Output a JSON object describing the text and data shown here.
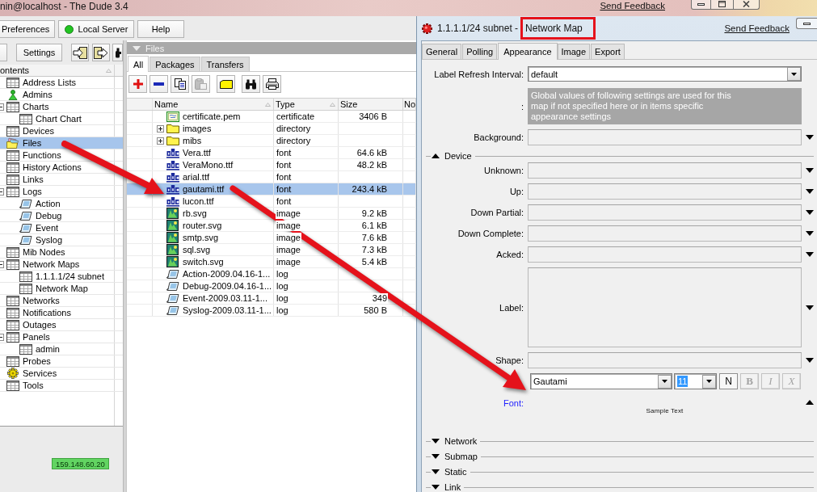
{
  "main_window": {
    "title": "nin@localhost - The Dude 3.4",
    "feedback_link": "Send Feedback",
    "preferences_button": "Preferences",
    "server_button": {
      "label": "Local Server",
      "connected": true
    },
    "help_button": "Help",
    "settings_button": "Settings",
    "contents_header": {
      "label": "ontents",
      "sort_mark": true
    },
    "tree": [
      {
        "label": "Address Lists",
        "kind": "table",
        "selected": false
      },
      {
        "label": "Admins",
        "kind": "admin",
        "selected": false
      },
      {
        "label": "Charts",
        "kind": "table",
        "selected": false,
        "expanded": true,
        "children": [
          {
            "label": "Chart Chart",
            "kind": "table",
            "selected": false
          }
        ]
      },
      {
        "label": "Devices",
        "kind": "table",
        "selected": false
      },
      {
        "label": "Files",
        "kind": "files",
        "selected": true
      },
      {
        "label": "Functions",
        "kind": "table",
        "selected": false
      },
      {
        "label": "History Actions",
        "kind": "table",
        "selected": false
      },
      {
        "label": "Links",
        "kind": "table",
        "selected": false
      },
      {
        "label": "Logs",
        "kind": "table",
        "selected": false,
        "expanded": true,
        "children": [
          {
            "label": "Action",
            "kind": "log",
            "selected": false
          },
          {
            "label": "Debug",
            "kind": "log",
            "selected": false
          },
          {
            "label": "Event",
            "kind": "log",
            "selected": false
          },
          {
            "label": "Syslog",
            "kind": "log",
            "selected": false
          }
        ]
      },
      {
        "label": "Mib Nodes",
        "kind": "table",
        "selected": false
      },
      {
        "label": "Network Maps",
        "kind": "table",
        "selected": false,
        "expanded": true,
        "children": [
          {
            "label": "1.1.1.1/24 subnet",
            "kind": "table",
            "selected": false
          },
          {
            "label": "Network Map",
            "kind": "table",
            "selected": false
          }
        ]
      },
      {
        "label": "Networks",
        "kind": "table",
        "selected": false
      },
      {
        "label": "Notifications",
        "kind": "table",
        "selected": false
      },
      {
        "label": "Outages",
        "kind": "table",
        "selected": false
      },
      {
        "label": "Panels",
        "kind": "table",
        "selected": false,
        "expanded": true,
        "children": [
          {
            "label": "admin",
            "kind": "table",
            "selected": false
          }
        ]
      },
      {
        "label": "Probes",
        "kind": "table",
        "selected": false
      },
      {
        "label": "Services",
        "kind": "services",
        "selected": false
      },
      {
        "label": "Tools",
        "kind": "table",
        "selected": false
      }
    ],
    "server_address": "159.148.60.20"
  },
  "files_panel": {
    "title": "Files",
    "tabs": [
      {
        "label": "All",
        "selected": true
      },
      {
        "label": "Packages",
        "selected": false
      },
      {
        "label": "Transfers",
        "selected": false
      }
    ],
    "tool_groups": [
      [
        {
          "kind": "add",
          "disabled": false
        },
        {
          "kind": "remove",
          "disabled": false
        },
        {
          "kind": "copy",
          "disabled": false
        },
        {
          "kind": "paste",
          "disabled": true
        }
      ],
      [
        {
          "kind": "folder",
          "disabled": false
        }
      ],
      [
        {
          "kind": "find",
          "disabled": false
        },
        {
          "kind": "print",
          "disabled": false
        }
      ]
    ],
    "columns": [
      {
        "label": "Name",
        "sort_mark": true
      },
      {
        "label": "Type",
        "sort_mark": true
      },
      {
        "label": "Size",
        "sort_mark": false
      },
      {
        "label": "No",
        "sort_mark": false
      }
    ],
    "rows": [
      {
        "name": "certificate.pem",
        "kind": "certificate",
        "type": "certificate",
        "size": "3406 B",
        "selected": false
      },
      {
        "name": "images",
        "kind": "folder",
        "type": "directory",
        "expanded": false,
        "selected": false
      },
      {
        "name": "mibs",
        "kind": "folder",
        "type": "directory",
        "expanded": false,
        "selected": false
      },
      {
        "name": "Vera.ttf",
        "kind": "font",
        "type": "font",
        "size": "64.6 kB",
        "selected": false
      },
      {
        "name": "VeraMono.ttf",
        "kind": "font",
        "type": "font",
        "size": "48.2 kB",
        "selected": false
      },
      {
        "name": "arial.ttf",
        "kind": "font",
        "type": "font",
        "selected": false
      },
      {
        "name": "gautami.ttf",
        "kind": "font",
        "type": "font",
        "size": "243.4 kB",
        "selected": true
      },
      {
        "name": "lucon.ttf",
        "kind": "font",
        "type": "font",
        "selected": false
      },
      {
        "name": "rb.svg",
        "kind": "image",
        "type": "image",
        "size": "9.2 kB",
        "selected": false
      },
      {
        "name": "router.svg",
        "kind": "image",
        "type": "image",
        "size": "6.1 kB",
        "selected": false
      },
      {
        "name": "smtp.svg",
        "kind": "image",
        "type": "image",
        "size": "7.6 kB",
        "selected": false
      },
      {
        "name": "sql.svg",
        "kind": "image",
        "type": "image",
        "size": "7.3 kB",
        "selected": false
      },
      {
        "name": "switch.svg",
        "kind": "image",
        "type": "image",
        "size": "5.4 kB",
        "selected": false
      },
      {
        "name": "Action-2009.04.16-1...",
        "kind": "log",
        "type": "log",
        "selected": false
      },
      {
        "name": "Debug-2009.04.16-1...",
        "kind": "log",
        "type": "log",
        "selected": false
      },
      {
        "name": "Event-2009.03.11-1...",
        "kind": "log",
        "type": "log",
        "size": "349",
        "selected": false
      },
      {
        "name": "Syslog-2009.03.11-1...",
        "kind": "log",
        "type": "log",
        "size": "580 B",
        "selected": false
      }
    ]
  },
  "map_window": {
    "title_parts": [
      {
        "text": "1.1.1.1/24 subnet -",
        "highlighted": false
      },
      {
        "text": "Network Map",
        "highlighted": true
      }
    ],
    "feedback_link": "Send Feedback",
    "tabs": [
      {
        "label": "General",
        "selected": false
      },
      {
        "label": "Polling",
        "selected": false
      },
      {
        "label": "Appearance",
        "selected": true
      },
      {
        "label": "Image",
        "selected": false
      },
      {
        "label": "Export",
        "selected": false
      }
    ],
    "fields": [
      {
        "kind": "combo",
        "label": "Label Refresh Interval:",
        "value": "default",
        "modified": false
      },
      {
        "kind": "note",
        "label": ":",
        "text": "Global values of following settings are used for this map if not specified here or in items specific appearance settings"
      },
      {
        "kind": "select",
        "label": "Background:",
        "modified": false
      }
    ],
    "sections": [
      {
        "title": "Device",
        "expanded": true,
        "fields": [
          {
            "kind": "select",
            "label": "Unknown:",
            "modified": false
          },
          {
            "kind": "select",
            "label": "Up:",
            "modified": false
          },
          {
            "kind": "select",
            "label": "Down Partial:",
            "modified": false
          },
          {
            "kind": "select",
            "label": "Down Complete:",
            "modified": false
          },
          {
            "kind": "select",
            "label": "Acked:",
            "modified": false
          },
          {
            "kind": "multiline",
            "label": "Label:",
            "modified": false
          },
          {
            "kind": "select",
            "label": "Shape:",
            "modified": false
          },
          {
            "kind": "font",
            "label": "Font:",
            "modified": true,
            "expanded": true,
            "font": "Gautami",
            "size": "11",
            "size_highlighted": true,
            "styles": [
              {
                "label": "N",
                "kind": "normal",
                "disabled": false
              },
              {
                "label": "B",
                "kind": "bold",
                "disabled": true
              },
              {
                "label": "I",
                "kind": "italic",
                "disabled": true
              },
              {
                "label": "X",
                "kind": "strikeout",
                "disabled": true
              }
            ],
            "sample": "Sample Text"
          }
        ]
      },
      {
        "title": "Network",
        "expanded": false
      },
      {
        "title": "Submap",
        "expanded": false
      },
      {
        "title": "Static",
        "expanded": false
      },
      {
        "title": "Link",
        "expanded": false
      }
    ]
  }
}
